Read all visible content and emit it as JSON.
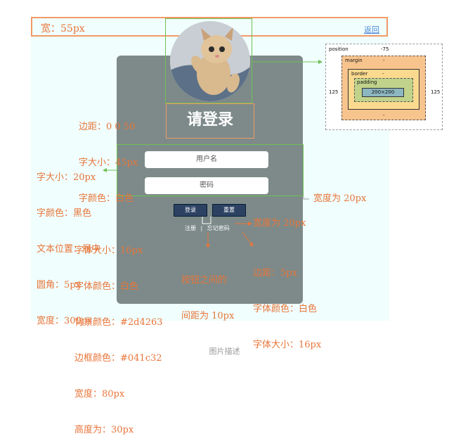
{
  "topbar": {
    "label": "宽：55px",
    "back": "返回"
  },
  "title": "请登录",
  "inputs": {
    "username_placeholder": "用户名",
    "password_placeholder": "密码"
  },
  "buttons": {
    "login": "登录",
    "reset": "重置"
  },
  "links": {
    "register": "注册",
    "separator": "|",
    "forgot": "忘记密码"
  },
  "annotations": {
    "title_style": [
      "边距：0 0 50",
      "字大小：45px",
      "字颜色：白色"
    ],
    "input_style": [
      "字大小：20px",
      "字颜色：黑色",
      "文本位置：居中",
      "圆角：5px",
      "宽度：300px"
    ],
    "input_gap": "宽度为 20px",
    "button_style": [
      "字体大小：16px",
      "字体颜色：白色",
      "背景颜色：#2d4263",
      "边框颜色：#041c32",
      "宽度：80px",
      "高度为：30px"
    ],
    "button_gap": "宽度为 20px",
    "button_spacing": [
      "按钮之间的",
      "间距为 10px"
    ],
    "link_style": [
      "边距：5px",
      "字体颜色：白色",
      "字体大小：16px"
    ]
  },
  "box_model": {
    "position": "position",
    "position_value": "-75",
    "margin": "margin",
    "border": "border",
    "padding": "padding",
    "content": "200×200",
    "left": "125",
    "right": "125",
    "dash": "-"
  },
  "caption": "图片描述",
  "colors": {
    "card": "#7d8a89",
    "button_bg": "#2d4263",
    "button_border": "#041c32",
    "annotation": "#e8753a",
    "highlight": "#6fc155"
  }
}
